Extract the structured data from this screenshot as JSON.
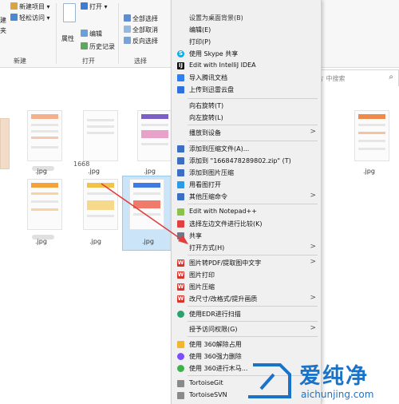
{
  "ribbon": {
    "new_item": "新建项目 ▾",
    "easy_access": "轻松访问 ▾",
    "left_frag_1": "建",
    "left_frag_2": "夹",
    "properties": "属性",
    "open": "打开 ▾",
    "edit": "编辑",
    "history": "历史记录",
    "select_all": "全部选择",
    "select_none": "全部取消",
    "invert_select": "反向选择",
    "group_new": "新建",
    "group_open": "打开",
    "group_select": "选择"
  },
  "search": {
    "text": "片 中搜索"
  },
  "files": {
    "names": [
      ".jpg",
      ".jpg",
      ".jpg",
      ".jpg",
      ".jpg",
      ".jpg",
      ".jpg",
      ".jpg"
    ],
    "partial_number": "1668"
  },
  "menu": {
    "top_clipped": "设置为桌面背景(B)",
    "items": [
      {
        "label": "编辑(E)",
        "icon": "none-icon",
        "arrow": ""
      },
      {
        "label": "打印(P)",
        "icon": "none-icon",
        "arrow": ""
      },
      {
        "label": "使用 Skype 共享",
        "icon": "skype-icon",
        "arrow": ""
      },
      {
        "label": "Edit with IntelliJ IDEA",
        "icon": "intellij-icon",
        "arrow": ""
      },
      {
        "label": "导入腾讯文档",
        "icon": "tencent-docs-icon",
        "arrow": ""
      },
      {
        "label": "上传到迅雷云盘",
        "icon": "thunder-cloud-icon",
        "arrow": ""
      },
      {
        "label": "向右旋转(T)",
        "icon": "none-icon",
        "arrow": ""
      },
      {
        "label": "向左旋转(L)",
        "icon": "none-icon",
        "arrow": ""
      },
      {
        "label": "播放到设备",
        "icon": "none-icon",
        "arrow": ">"
      },
      {
        "label": "添加到压缩文件(A)...",
        "icon": "winrar-icon",
        "arrow": ""
      },
      {
        "label": "添加到 \"1668478289802.zip\" (T)",
        "icon": "winrar-icon",
        "arrow": ""
      },
      {
        "label": "添加到图片压缩",
        "icon": "winrar-icon",
        "arrow": ""
      },
      {
        "label": "用看图打开",
        "icon": "image-viewer-icon",
        "arrow": ""
      },
      {
        "label": "其他压缩命令",
        "icon": "winrar-icon",
        "arrow": ">"
      },
      {
        "label": "Edit with Notepad++",
        "icon": "notepadpp-icon",
        "arrow": ""
      },
      {
        "label": "选择左边文件进行比较(K)",
        "icon": "compare-icon",
        "arrow": ""
      },
      {
        "label": "共享",
        "icon": "share-icon",
        "arrow": ""
      },
      {
        "label": "打开方式(H)",
        "icon": "none-icon",
        "arrow": ">"
      },
      {
        "label": "图片转PDF/提取图中文字",
        "icon": "wps-icon",
        "arrow": ">"
      },
      {
        "label": "图片打印",
        "icon": "wps-icon",
        "arrow": ""
      },
      {
        "label": "图片压缩",
        "icon": "wps-icon",
        "arrow": ""
      },
      {
        "label": "改尺寸/改格式/提升画质",
        "icon": "wps-icon",
        "arrow": ">"
      },
      {
        "label": "使用EDR进行扫描",
        "icon": "edr-icon",
        "arrow": ""
      },
      {
        "label": "授予访问权限(G)",
        "icon": "none-icon",
        "arrow": ">"
      },
      {
        "label": "使用 360解除占用",
        "icon": "360-unlock-icon",
        "arrow": ""
      },
      {
        "label": "使用 360强力删除",
        "icon": "360-delete-icon",
        "arrow": ""
      },
      {
        "label": "使用 360进行木马...",
        "icon": "360-scan-icon",
        "arrow": ""
      },
      {
        "label": "TortoiseGit",
        "icon": "tortoisegit-icon",
        "arrow": ""
      },
      {
        "label": "TortoiseSVN",
        "icon": "tortoisesvn-icon",
        "arrow": ""
      }
    ]
  },
  "watermark": {
    "brand": "爱纯净",
    "url": "aichunjing.com"
  },
  "colors": {
    "ribbon_bg": "#f7f7f7",
    "menu_bg": "#f0f0f0",
    "selection": "#cce4f7",
    "arrow": "#e04040",
    "watermark": "#1a73c8",
    "wps": "#d9342b",
    "winrar": "#3a6fc4"
  }
}
